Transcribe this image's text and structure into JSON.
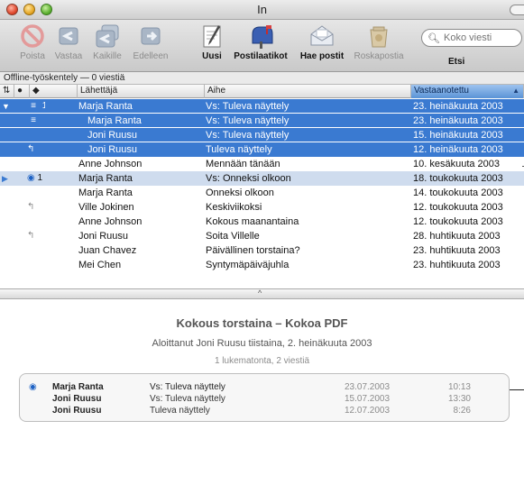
{
  "window": {
    "title": "In"
  },
  "toolbar": {
    "buttons": [
      {
        "label": "Poista",
        "icon": "delete-icon",
        "enabled": false
      },
      {
        "label": "Vastaa",
        "icon": "reply-icon",
        "enabled": false
      },
      {
        "label": "Kaikille",
        "icon": "reply-all-icon",
        "enabled": false
      },
      {
        "label": "Edelleen",
        "icon": "forward-icon",
        "enabled": false
      },
      {
        "label": "Uusi",
        "icon": "compose-icon",
        "enabled": true
      },
      {
        "label": "Postilaatikot",
        "icon": "mailboxes-icon",
        "enabled": true
      },
      {
        "label": "Hae postit",
        "icon": "get-mail-icon",
        "enabled": true
      },
      {
        "label": "Roskapostia",
        "icon": "junk-icon",
        "enabled": false
      }
    ],
    "search_placeholder": "Koko viesti",
    "search_label": "Etsi"
  },
  "status": {
    "text": "Offline-työskentely — 0 viestiä"
  },
  "columns": {
    "from": "Lähettäjä",
    "subject": "Aihe",
    "received": "Vastaanotettu"
  },
  "messages": [
    {
      "expander": "▼",
      "status": "1",
      "status_kind": "thread-count",
      "from": "Marja Ranta",
      "subject": "Vs: Tuleva näyttely",
      "date": "23. heinäkuuta 2003",
      "selected": true,
      "indent": false
    },
    {
      "expander": "",
      "status": "",
      "status_kind": "thread-member",
      "from": "Marja Ranta",
      "subject": "Vs: Tuleva näyttely",
      "date": "23. heinäkuuta 2003",
      "selected": true,
      "indent": true
    },
    {
      "expander": "",
      "status": "",
      "status_kind": "none",
      "from": "Joni Ruusu",
      "subject": "Vs: Tuleva näyttely",
      "date": "15. heinäkuuta 2003",
      "selected": true,
      "indent": true
    },
    {
      "expander": "",
      "status": "",
      "status_kind": "replied",
      "from": "Joni Ruusu",
      "subject": "Tuleva näyttely",
      "date": "12. heinäkuuta 2003",
      "selected": true,
      "indent": true
    },
    {
      "expander": "",
      "status": "",
      "status_kind": "none",
      "from": "Anne Johnson",
      "subject": "Mennään tänään",
      "date": "10. kesäkuuta 2003",
      "selected": false,
      "indent": false
    },
    {
      "expander": "▶",
      "status": "1",
      "status_kind": "unread-thread",
      "from": "Marja Ranta",
      "subject": "Vs: Onneksi olkoon",
      "date": "18. toukokuuta 2003",
      "selected": false,
      "highlight": true,
      "indent": false
    },
    {
      "expander": "",
      "status": "",
      "status_kind": "none",
      "from": "Marja Ranta",
      "subject": "Onneksi olkoon",
      "date": "14. toukokuuta 2003",
      "selected": false,
      "indent": false
    },
    {
      "expander": "",
      "status": "",
      "status_kind": "replied",
      "from": "Ville Jokinen",
      "subject": "Keskiviikoksi",
      "date": "12. toukokuuta 2003",
      "selected": false,
      "indent": false
    },
    {
      "expander": "",
      "status": "",
      "status_kind": "none",
      "from": "Anne Johnson",
      "subject": "Kokous maanantaina",
      "date": "12. toukokuuta 2003",
      "selected": false,
      "indent": false
    },
    {
      "expander": "",
      "status": "",
      "status_kind": "replied",
      "from": "Joni Ruusu",
      "subject": "Soita Villelle",
      "date": "28. huhtikuuta 2003",
      "selected": false,
      "indent": false
    },
    {
      "expander": "",
      "status": "",
      "status_kind": "none",
      "from": "Juan Chavez",
      "subject": "Päivällinen torstaina?",
      "date": "23. huhtikuuta 2003",
      "selected": false,
      "indent": false
    },
    {
      "expander": "",
      "status": "",
      "status_kind": "none",
      "from": "Mei Chen",
      "subject": "Syntymäpäiväjuhla",
      "date": "23. huhtikuuta 2003",
      "selected": false,
      "indent": false
    }
  ],
  "preview": {
    "title": "Kokous torstaina – Kokoa PDF",
    "started": "Aloittanut Joni Ruusu tiistaina, 2. heinäkuuta 2003",
    "count": "1 lukematonta, 2 viestiä",
    "messages": [
      {
        "unread": true,
        "from": "Marja Ranta",
        "subject": "Vs: Tuleva näyttely",
        "date": "23.07.2003",
        "time": "10:13"
      },
      {
        "unread": false,
        "from": "Joni Ruusu",
        "subject": "Vs: Tuleva näyttely",
        "date": "15.07.2003",
        "time": "13:30"
      },
      {
        "unread": false,
        "from": "Joni Ruusu",
        "subject": "Tuleva näyttely",
        "date": "12.07.2003",
        "time": "8:26"
      }
    ]
  },
  "colors": {
    "selection": "#3a7ad1",
    "highlight": "#cfdcee",
    "unread": "#1e62c4"
  }
}
